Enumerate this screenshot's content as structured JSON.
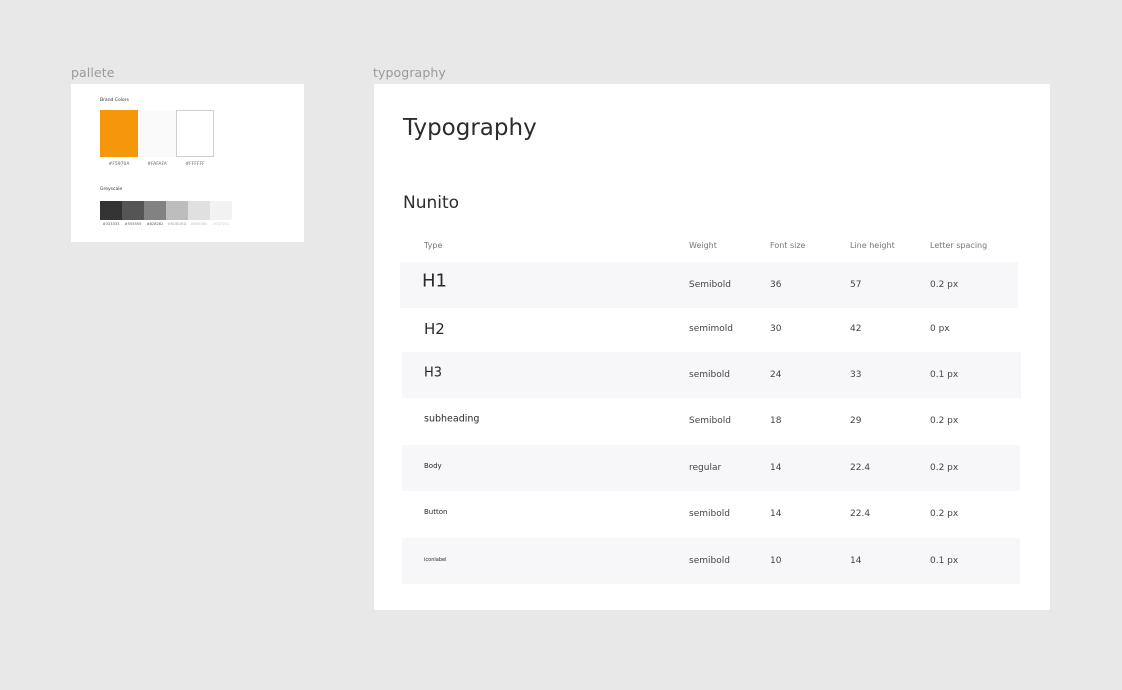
{
  "pallete": {
    "frame_label": "pallete",
    "brand_title": "Brand Colors",
    "brand_colors": [
      {
        "hex": "#F5970A",
        "label": "#F5970A"
      },
      {
        "hex": "#FAFAFA",
        "label": "#FAFAFA"
      },
      {
        "hex": "#FFFFFF",
        "label": "#FFFFFF"
      }
    ],
    "grayscale_title": "Greyscale",
    "grayscale": [
      {
        "hex": "#333333",
        "label": "#333333"
      },
      {
        "hex": "#555555",
        "label": "#555555"
      },
      {
        "hex": "#828282",
        "label": "#828282"
      },
      {
        "hex": "#BDBDBD",
        "label": "#BDBDBD"
      },
      {
        "hex": "#E0E0E0",
        "label": "#E0E0E0"
      },
      {
        "hex": "#F2F2F2",
        "label": "#F2F2F2"
      }
    ]
  },
  "typography": {
    "frame_label": "typography",
    "title": "Typography",
    "font_name": "Nunito",
    "headers": {
      "type": "Type",
      "weight": "Weight",
      "font_size": "Font size",
      "line_height": "Line height",
      "letter_spacing": "Letter spacing"
    },
    "rows": [
      {
        "type": "H1",
        "weight": "Semibold",
        "font_size": "36",
        "line_height": "57",
        "letter_spacing": "0.2 px"
      },
      {
        "type": "H2",
        "weight": "semimold",
        "font_size": "30",
        "line_height": "42",
        "letter_spacing": "0 px"
      },
      {
        "type": "H3",
        "weight": "semibold",
        "font_size": "24",
        "line_height": "33",
        "letter_spacing": "0.1 px"
      },
      {
        "type": "subheading",
        "weight": "Semibold",
        "font_size": "18",
        "line_height": "29",
        "letter_spacing": "0.2 px"
      },
      {
        "type": "Body",
        "weight": "regular",
        "font_size": "14",
        "line_height": "22.4",
        "letter_spacing": "0.2 px"
      },
      {
        "type": "Button",
        "weight": "semibold",
        "font_size": "14",
        "line_height": "22.4",
        "letter_spacing": "0.2 px"
      },
      {
        "type": "iconlabel",
        "weight": "semibold",
        "font_size": "10",
        "line_height": "14",
        "letter_spacing": "0.1 px"
      }
    ]
  }
}
